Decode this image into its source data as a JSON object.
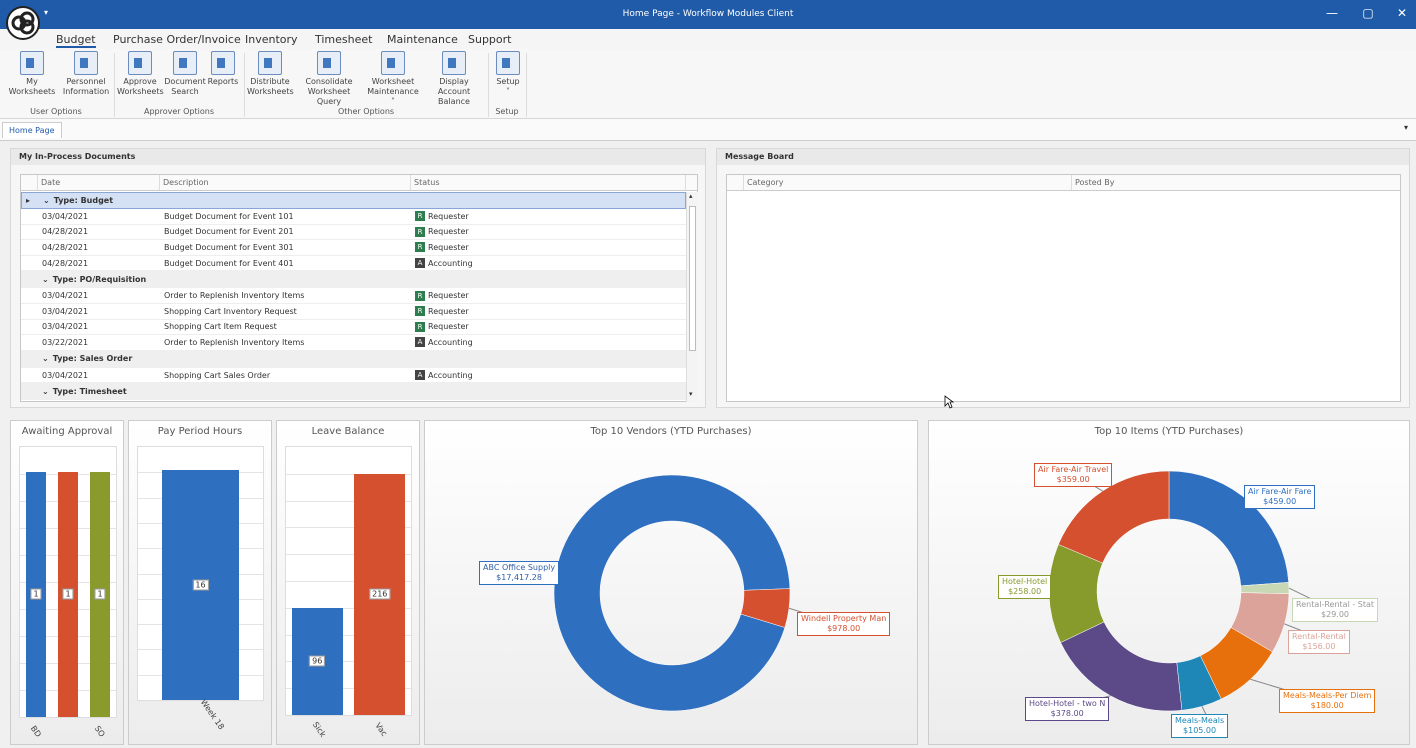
{
  "window": {
    "title": "Home Page - Workflow Modules Client",
    "minimize": "—",
    "maximize": "▢",
    "close": "✕"
  },
  "ribbon": {
    "tabs": [
      "Budget",
      "Purchase Order/Invoice",
      "Inventory",
      "Timesheet",
      "Maintenance",
      "Support"
    ],
    "active_tab": "Budget",
    "buttons": [
      {
        "l1": "My Worksheets",
        "l2": "",
        "icon": "worksheet-user-icon"
      },
      {
        "l1": "Personnel",
        "l2": "Information",
        "icon": "personnel-icon"
      },
      {
        "l1": "Approve",
        "l2": "Worksheets",
        "icon": "approve-icon"
      },
      {
        "l1": "Document",
        "l2": "Search",
        "icon": "document-search-icon"
      },
      {
        "l1": "Reports",
        "l2": "",
        "icon": "reports-icon"
      },
      {
        "l1": "Distribute",
        "l2": "Worksheets",
        "icon": "distribute-icon"
      },
      {
        "l1": "Consolidate",
        "l2": "Worksheet Query",
        "icon": "consolidate-icon"
      },
      {
        "l1": "Worksheet",
        "l2": "Maintenance ˅",
        "icon": "worksheet-maintenance-icon"
      },
      {
        "l1": "Display Account",
        "l2": "Balance",
        "icon": "account-balance-icon"
      },
      {
        "l1": "Setup",
        "l2": "˅",
        "icon": "setup-sliders-icon"
      }
    ],
    "groups": [
      "User Options",
      "Approver Options",
      "Other Options",
      "Setup"
    ]
  },
  "doc_tab": "Home Page",
  "in_process": {
    "title": "My In-Process Documents",
    "columns": [
      "Date",
      "Description",
      "Status"
    ],
    "groups": [
      {
        "label": "Type: Budget",
        "rows": [
          {
            "date": "03/04/2021",
            "desc": "Budget Document for Event 101",
            "badge": "R",
            "status": "Requester"
          },
          {
            "date": "04/28/2021",
            "desc": "Budget Document for Event 201",
            "badge": "R",
            "status": "Requester"
          },
          {
            "date": "04/28/2021",
            "desc": "Budget Document for Event 301",
            "badge": "R",
            "status": "Requester"
          },
          {
            "date": "04/28/2021",
            "desc": "Budget Document for Event 401",
            "badge": "A",
            "status": "Accounting"
          }
        ]
      },
      {
        "label": "Type: PO/Requisition",
        "rows": [
          {
            "date": "03/04/2021",
            "desc": "Order to Replenish Inventory Items",
            "badge": "R",
            "status": "Requester"
          },
          {
            "date": "03/04/2021",
            "desc": "Shopping Cart Inventory Request",
            "badge": "R",
            "status": "Requester"
          },
          {
            "date": "03/04/2021",
            "desc": "Shopping Cart Item Request",
            "badge": "R",
            "status": "Requester"
          },
          {
            "date": "03/22/2021",
            "desc": "Order to Replenish Inventory Items",
            "badge": "A",
            "status": "Accounting"
          }
        ]
      },
      {
        "label": "Type: Sales Order",
        "rows": [
          {
            "date": "03/04/2021",
            "desc": "Shopping Cart Sales Order",
            "badge": "A",
            "status": "Accounting"
          }
        ]
      },
      {
        "label": "Type: Timesheet",
        "rows": []
      }
    ],
    "badge_colors": {
      "R": "#2e7d4f",
      "A": "#444444"
    }
  },
  "message_board": {
    "title": "Message Board",
    "columns": [
      "Category",
      "Posted By"
    ]
  },
  "chart_data": [
    {
      "type": "bar",
      "title": "Awaiting Approval",
      "categories": [
        "BD",
        "PO",
        "SO"
      ],
      "tick_labels": [
        "BD",
        "",
        "SO"
      ],
      "values": [
        1,
        1,
        1
      ],
      "colors": [
        "#2e6fc0",
        "#d4502e",
        "#8a9a2c"
      ],
      "ylim": [
        0,
        1.1
      ]
    },
    {
      "type": "bar",
      "title": "Pay Period Hours",
      "categories": [
        "Week 18"
      ],
      "values": [
        16
      ],
      "colors": [
        "#2e6fc0"
      ],
      "ylim": [
        0,
        17.6
      ]
    },
    {
      "type": "bar",
      "title": "Leave Balance",
      "categories": [
        "Sick",
        "Vac"
      ],
      "values": [
        96,
        216
      ],
      "colors": [
        "#2e6fc0",
        "#d4502e"
      ],
      "ylim": [
        0,
        240
      ]
    },
    {
      "type": "pie",
      "donut": true,
      "title": "Top 10 Vendors (YTD Purchases)",
      "labels": [
        "ABC Office Supply",
        "Windell Property Man"
      ],
      "values": [
        17417.28,
        978.0
      ],
      "value_labels": [
        "$17,417.28",
        "$978.00"
      ],
      "colors": [
        "#2e6fc0",
        "#d4502e"
      ]
    },
    {
      "type": "pie",
      "donut": true,
      "title": "Top 10 Items (YTD Purchases)",
      "labels": [
        "Air Fare-Air Fare",
        "Rental-Rental - Stat",
        "Rental-Rental",
        "Meals-Meals-Per Diem",
        "Meals-Meals",
        "Hotel-Hotel - two N",
        "Hotel-Hotel",
        "Air Fare-Air Travel"
      ],
      "values": [
        459,
        29,
        156,
        180,
        105,
        378,
        258,
        359
      ],
      "value_labels": [
        "$459.00",
        "$29.00",
        "$156.00",
        "$180.00",
        "$105.00",
        "$378.00",
        "$258.00",
        "$359.00"
      ],
      "colors": [
        "#2e6fc0",
        "#c9d8b4",
        "#dba39a",
        "#e8700c",
        "#1f87b8",
        "#5c4a88",
        "#879a2c",
        "#d4502e"
      ]
    }
  ]
}
